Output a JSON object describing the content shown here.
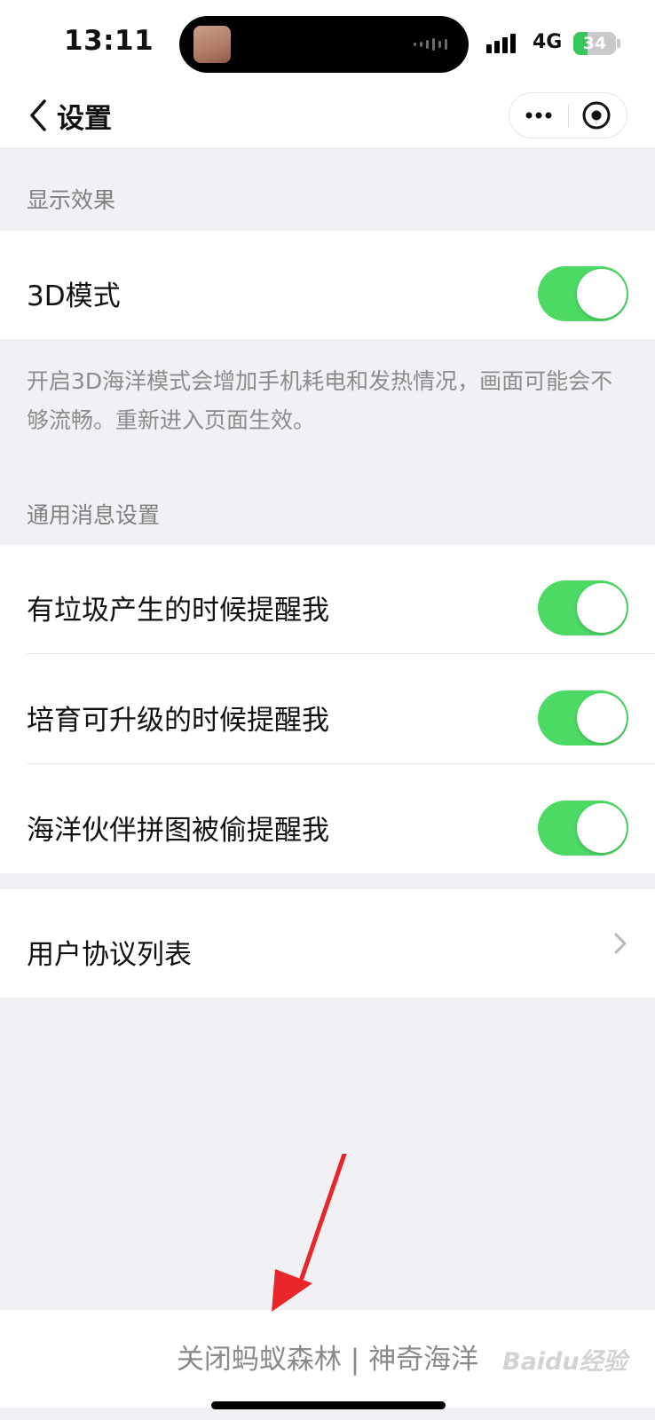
{
  "status_bar": {
    "time": "13:11",
    "network": "4G",
    "battery": "34",
    "battery_level": 0.34
  },
  "nav": {
    "title": "设置"
  },
  "sections": {
    "display": {
      "header": "显示效果",
      "mode_3d": {
        "label": "3D模式",
        "enabled": true
      },
      "hint": "开启3D海洋模式会增加手机耗电和发热情况，画面可能会不够流畅。重新进入页面生效。"
    },
    "notifications": {
      "header": "通用消息设置",
      "items": [
        {
          "label": "有垃圾产生的时候提醒我",
          "enabled": true
        },
        {
          "label": "培育可升级的时候提醒我",
          "enabled": true
        },
        {
          "label": "海洋伙伴拼图被偷提醒我",
          "enabled": true
        }
      ]
    },
    "agreements": {
      "label": "用户协议列表"
    }
  },
  "footer": {
    "action": "关闭蚂蚁森林 | 神奇海洋"
  },
  "watermark": "Baidu经验",
  "colors": {
    "toggle_on": "#4cd964",
    "background": "#f1f1f5",
    "annotation_arrow": "#e8262a"
  }
}
